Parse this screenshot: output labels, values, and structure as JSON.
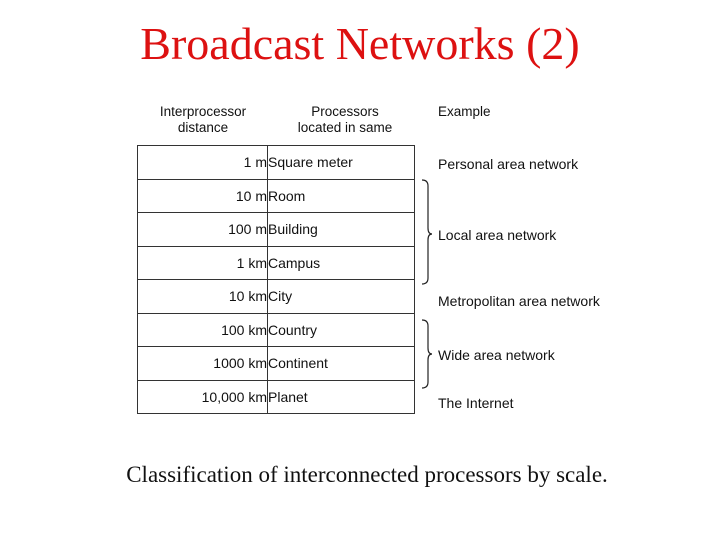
{
  "title": "Broadcast Networks (2)",
  "table": {
    "headers": {
      "distance": "Interprocessor distance",
      "distance_line1": "Interprocessor",
      "distance_line2": "distance",
      "located": "Processors located in same",
      "located_line1": "Processors",
      "located_line2": "located in same",
      "example": "Example"
    },
    "rows": [
      {
        "distance": "1 m",
        "located": "Square meter"
      },
      {
        "distance": "10 m",
        "located": "Room"
      },
      {
        "distance": "100 m",
        "located": "Building"
      },
      {
        "distance": "1 km",
        "located": "Campus"
      },
      {
        "distance": "10 km",
        "located": "City"
      },
      {
        "distance": "100 km",
        "located": "Country"
      },
      {
        "distance": "1000 km",
        "located": "Continent"
      },
      {
        "distance": "10,000 km",
        "located": "Planet"
      }
    ],
    "examples": [
      {
        "label": "Personal area network",
        "rows": "1 m"
      },
      {
        "label": "Local area network",
        "rows": "10 m – 1 km"
      },
      {
        "label": "Metropolitan area network",
        "rows": "10 km"
      },
      {
        "label": "Wide area network",
        "rows": "100 km – 1000 km"
      },
      {
        "label": "The Internet",
        "rows": "10,000 km"
      }
    ]
  },
  "caption": "Classification of interconnected processors by scale."
}
